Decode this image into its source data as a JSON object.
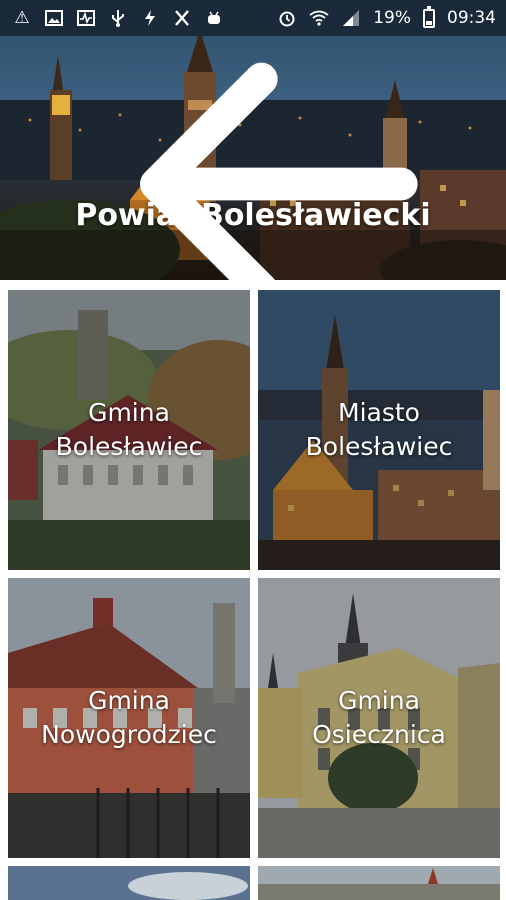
{
  "status_bar": {
    "battery": "19%",
    "time": "09:34",
    "icons_left": [
      "warning-icon",
      "image-icon",
      "pulse-icon",
      "usb-icon",
      "flash-icon",
      "tools-icon",
      "android-icon"
    ],
    "icons_right": [
      "alarm-icon",
      "wifi-icon",
      "signal-icon",
      "battery-icon"
    ]
  },
  "header": {
    "title": "Powiat Bolesławiecki",
    "back_icon": "arrow-left-icon"
  },
  "tiles": [
    {
      "line1": "Gmina",
      "line2": "Bolesławiec"
    },
    {
      "line1": "Miasto",
      "line2": "Bolesławiec"
    },
    {
      "line1": "Gmina",
      "line2": "Nowogrodziec"
    },
    {
      "line1": "Gmina",
      "line2": "Osiecznica"
    }
  ],
  "colors": {
    "status_bar_bg": "#1a2a3a",
    "text": "#ffffff",
    "background": "#ffffff"
  }
}
